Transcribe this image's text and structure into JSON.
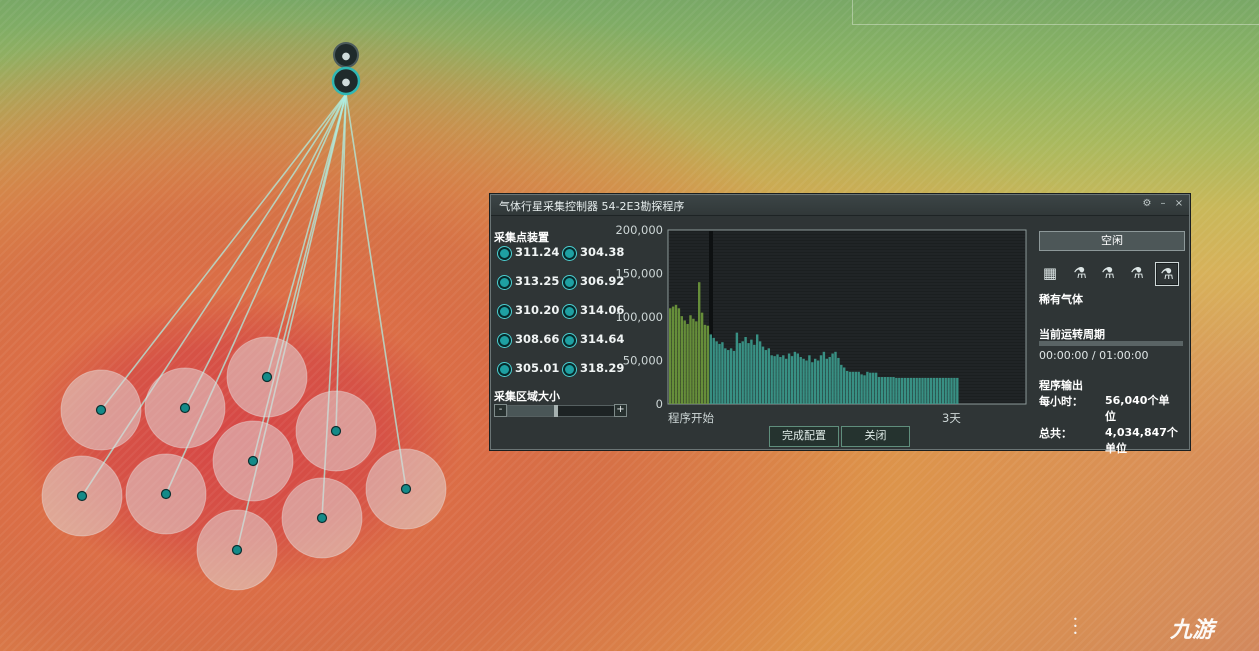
{
  "window": {
    "title": "气体行星采集控制器 54-2E3勘探程序",
    "controls": [
      "⚙",
      "–",
      "×"
    ]
  },
  "probes_section": {
    "label": "采集点装置",
    "probes": [
      "311.24",
      "304.38",
      "313.25",
      "306.92",
      "310.20",
      "314.06",
      "308.66",
      "314.64",
      "305.01",
      "318.29"
    ]
  },
  "area_size": {
    "label": "采集区域大小",
    "minus": "-",
    "plus": "+",
    "level": 0.45
  },
  "chart": {
    "buttons": {
      "finish": "完成配置",
      "close": "关闭"
    }
  },
  "chart_data": {
    "type": "bar",
    "yticks": [
      "200,000",
      "150,000",
      "100,000",
      "50,000",
      "0"
    ],
    "xlabel_start": "程序开始",
    "xlabel_end": "3天",
    "ylim": [
      0,
      200000
    ],
    "values": [
      110000,
      112000,
      114000,
      110000,
      101000,
      96000,
      92000,
      102000,
      98000,
      95000,
      140000,
      105000,
      91000,
      90000,
      80000,
      76000,
      72000,
      69000,
      71000,
      64000,
      62000,
      64000,
      61000,
      82000,
      70000,
      72000,
      77000,
      70000,
      74000,
      68000,
      80000,
      72000,
      66000,
      62000,
      64000,
      56000,
      55000,
      57000,
      54000,
      56000,
      52000,
      58000,
      55000,
      60000,
      58000,
      54000,
      52000,
      50000,
      56000,
      48000,
      52000,
      50000,
      56000,
      60000,
      52000,
      54000,
      58000,
      60000,
      53000,
      45000,
      42000,
      38000,
      37000,
      37000,
      37000,
      37000,
      34000,
      33000,
      37000,
      36000,
      36000,
      36000,
      31000,
      31000,
      31000,
      31000,
      31000,
      31000,
      30000,
      30000,
      30000,
      30000,
      30000,
      30000,
      30000,
      30000,
      30000,
      30000,
      30000,
      30000,
      30000,
      30000,
      30000,
      30000,
      30000,
      30000,
      30000,
      30000,
      30000,
      30000
    ]
  },
  "status": {
    "button": "空闲",
    "gas_icons": [
      "rare-gas-icon",
      "gas-canister-icon-1",
      "gas-canister-icon-2",
      "gas-canister-icon-3",
      "gas-canister-icon-4"
    ],
    "gas_name": "稀有气体",
    "cycle_label": "当前运转周期",
    "cycle_progress": 0,
    "cycle_time": "00:00:00 / 01:00:00",
    "output_label": "程序输出",
    "per_hour_label": "每小时：",
    "per_hour_value": "56,040个单位",
    "total_label": "总共：",
    "total_value": "4,034,847个单位"
  },
  "watermark": "九游"
}
